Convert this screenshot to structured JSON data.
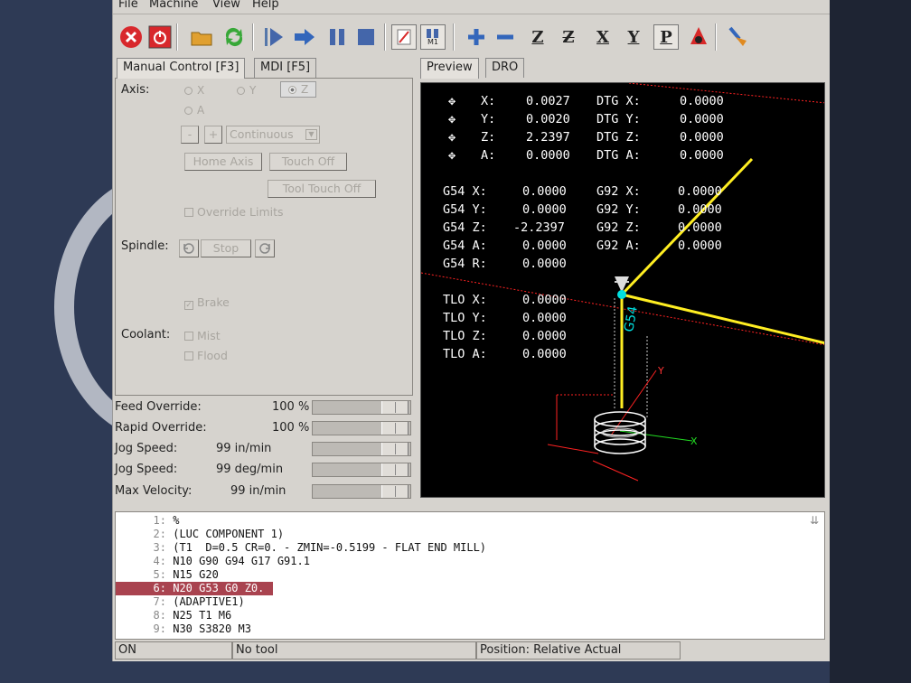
{
  "menu": [
    "File",
    "Machine",
    "View",
    "Help"
  ],
  "toolbar_icons": [
    "estop-icon",
    "power-icon",
    "open-file-icon",
    "reload-icon",
    "run-icon",
    "step-icon",
    "pause-icon",
    "stop-icon",
    "block-delete-icon",
    "optional-stop-icon",
    "zoom-in-icon",
    "zoom-out-icon",
    "view-z-icon",
    "view-z2-icon",
    "view-x-icon",
    "view-y-icon",
    "view-p-icon",
    "rotate-icon",
    "clear-plot-icon"
  ],
  "view_buttons": {
    "z": "Z",
    "z2": "Z",
    "x": "X",
    "y": "Y",
    "p": "P",
    "m1": "M1"
  },
  "left_tabs": [
    "Manual Control [F3]",
    "MDI [F5]"
  ],
  "right_tabs": [
    "Preview",
    "DRO"
  ],
  "manual": {
    "axis_label": "Axis:",
    "axes": [
      "X",
      "Y",
      "Z",
      "A"
    ],
    "selected_axis": "Z",
    "jog_minus": "-",
    "jog_plus": "+",
    "jog_mode": "Continuous",
    "home_axis": "Home Axis",
    "touch_off": "Touch Off",
    "tool_touch_off": "Tool Touch Off",
    "override_limits": "Override Limits",
    "spindle_label": "Spindle:",
    "spindle_stop": "Stop",
    "brake": "Brake",
    "coolant_label": "Coolant:",
    "mist": "Mist",
    "flood": "Flood"
  },
  "overrides": [
    {
      "name": "Feed Override:",
      "value": "100 %",
      "level": 1.0
    },
    {
      "name": "Rapid Override:",
      "value": "100 %",
      "level": 1.0
    },
    {
      "name": "Jog Speed:",
      "value": "99 in/min",
      "level": 1.0
    },
    {
      "name": "Jog Speed:",
      "value": "99 deg/min",
      "level": 1.0
    },
    {
      "name": "Max Velocity:",
      "value": "99 in/min",
      "level": 1.0
    }
  ],
  "dro": {
    "pos": [
      {
        "axis": "X:",
        "value": "0.0027",
        "dtg_label": "DTG X:",
        "dtg": "0.0000"
      },
      {
        "axis": "Y:",
        "value": "0.0020",
        "dtg_label": "DTG Y:",
        "dtg": "0.0000"
      },
      {
        "axis": "Z:",
        "value": "2.2397",
        "dtg_label": "DTG Z:",
        "dtg": "0.0000"
      },
      {
        "axis": "A:",
        "value": "0.0000",
        "dtg_label": "DTG A:",
        "dtg": "0.0000"
      }
    ],
    "g54": [
      {
        "label": "G54 X:",
        "value": "0.0000",
        "g92_label": "G92 X:",
        "g92": "0.0000"
      },
      {
        "label": "G54 Y:",
        "value": "0.0000",
        "g92_label": "G92 Y:",
        "g92": "0.0000"
      },
      {
        "label": "G54 Z:",
        "value": "-2.2397",
        "g92_label": "G92 Z:",
        "g92": "0.0000"
      },
      {
        "label": "G54 A:",
        "value": "0.0000",
        "g92_label": "G92 A:",
        "g92": "0.0000"
      },
      {
        "label": "G54 R:",
        "value": "0.0000"
      }
    ],
    "tlo": [
      {
        "label": "TLO X:",
        "value": "0.0000"
      },
      {
        "label": "TLO Y:",
        "value": "0.0000"
      },
      {
        "label": "TLO Z:",
        "value": "0.0000"
      },
      {
        "label": "TLO A:",
        "value": "0.0000"
      }
    ],
    "g54_tag": "G54"
  },
  "gcode": [
    {
      "n": "1:",
      "text": "%"
    },
    {
      "n": "2:",
      "text": "(LUC COMPONENT 1)"
    },
    {
      "n": "3:",
      "text": "(T1  D=0.5 CR=0. - ZMIN=-0.5199 - FLAT END MILL)"
    },
    {
      "n": "4:",
      "text": "N10 G90 G94 G17 G91.1"
    },
    {
      "n": "5:",
      "text": "N15 G20"
    },
    {
      "n": "6:",
      "text": "N20 G53 G0 Z0."
    },
    {
      "n": "7:",
      "text": "(ADAPTIVE1)"
    },
    {
      "n": "8:",
      "text": "N25 T1 M6"
    },
    {
      "n": "9:",
      "text": "N30 S3820 M3"
    }
  ],
  "highlight_line": 5,
  "status": {
    "state": "ON",
    "tool": "No tool",
    "position": "Position: Relative Actual"
  },
  "colors": {
    "highlight": "#a9434f",
    "path": "#ffee22",
    "tool": "#00e0e0",
    "axis_x": "#22dd22",
    "axis_y": "#ff3333",
    "limits": "#ff2222"
  }
}
